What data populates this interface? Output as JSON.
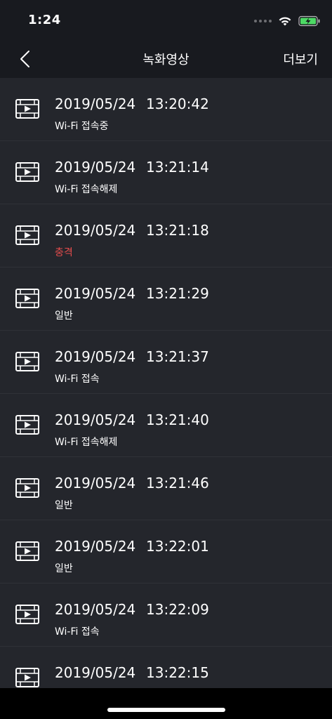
{
  "status_bar": {
    "time": "1:24"
  },
  "nav": {
    "title": "녹화영상",
    "more_label": "더보기",
    "back_icon": "chevron-left-icon"
  },
  "colors": {
    "background": "#24262c",
    "header": "#181a1f",
    "impact": "#e54c4c"
  },
  "recordings": [
    {
      "date": "2019/05/24",
      "time": "13:20:42",
      "status": "Wi-Fi 접속중",
      "type": "normal"
    },
    {
      "date": "2019/05/24",
      "time": "13:21:14",
      "status": "Wi-Fi 접속해제",
      "type": "normal"
    },
    {
      "date": "2019/05/24",
      "time": "13:21:18",
      "status": "충격",
      "type": "impact"
    },
    {
      "date": "2019/05/24",
      "time": "13:21:29",
      "status": "일반",
      "type": "normal"
    },
    {
      "date": "2019/05/24",
      "time": "13:21:37",
      "status": "Wi-Fi 접속",
      "type": "normal"
    },
    {
      "date": "2019/05/24",
      "time": "13:21:40",
      "status": "Wi-Fi 접속해제",
      "type": "normal"
    },
    {
      "date": "2019/05/24",
      "time": "13:21:46",
      "status": "일반",
      "type": "normal"
    },
    {
      "date": "2019/05/24",
      "time": "13:22:01",
      "status": "일반",
      "type": "normal"
    },
    {
      "date": "2019/05/24",
      "time": "13:22:09",
      "status": "Wi-Fi 접속",
      "type": "normal"
    },
    {
      "date": "2019/05/24",
      "time": "13:22:15",
      "status": "",
      "type": "normal"
    }
  ]
}
